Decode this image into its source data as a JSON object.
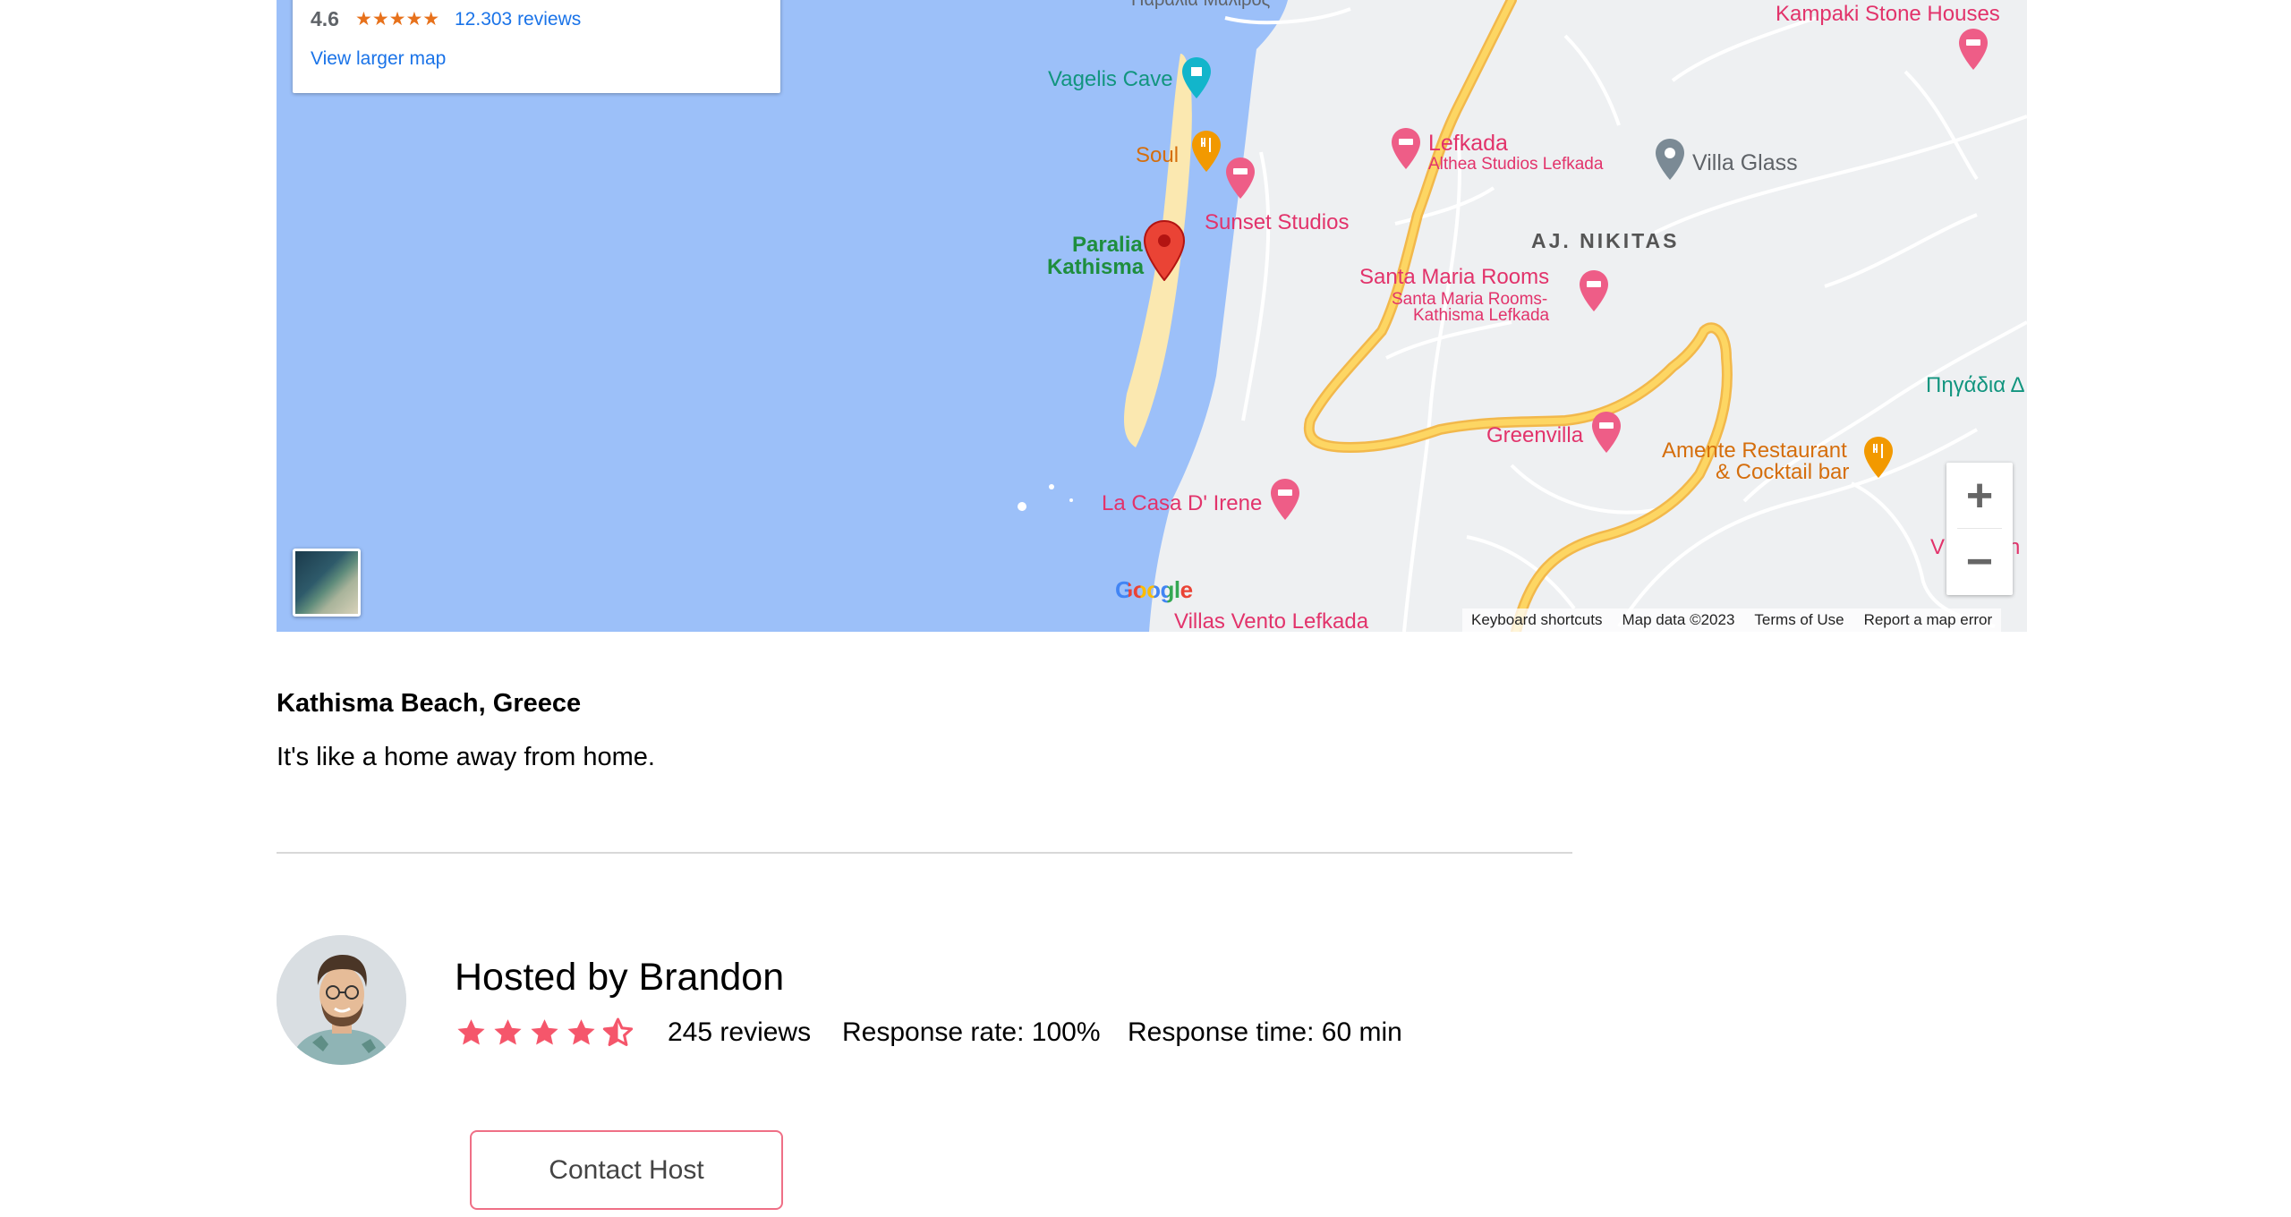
{
  "map": {
    "info_card": {
      "rating": "4.6",
      "stars": "★★★★★",
      "reviews_link": "12.303 reviews",
      "larger_map_link": "View larger map"
    },
    "labels": {
      "vagelis_cave": "Vagelis Cave",
      "soul": "Soul",
      "sunset_studios": "Sunset Studios",
      "paralia_kathisma_1": "Paralia",
      "paralia_kathisma_2": "Kathisma",
      "lefkada": "Lefkada",
      "althea": "Althea Studios Lefkada",
      "villa_glass": "Villa Glass",
      "aj_nikitas": "AJ. NIKITAS",
      "santa_maria": "Santa Maria Rooms",
      "santa_maria_sub_1": "Santa Maria Rooms-",
      "santa_maria_sub_2": "Kathisma Lefkada",
      "kampaki": "Kampaki Stone Houses",
      "pigadia": "Πηγάδια Δ",
      "greenvilla": "Greenvilla",
      "amente_1": "Amente Restaurant",
      "amente_2": "& Cocktail bar",
      "la_casa": "La Casa D' Irene",
      "villas_vento": "Villas Vento Lefkada",
      "partial_v": "V",
      "partial_n": "n",
      "top_partial": "Παραλία Μαλίρος"
    },
    "zoom_in": "+",
    "zoom_out": "−",
    "google_logo": "Google",
    "attribution": {
      "shortcuts": "Keyboard shortcuts",
      "data": "Map data ©2023",
      "terms": "Terms of Use",
      "report": "Report a map error"
    },
    "colors": {
      "water": "#9cc0f9",
      "land": "#eef0f2",
      "road": "#fdd663",
      "road_edge": "#f2b84b",
      "beach": "#fbe8b0",
      "poi_pink": "#e2336b",
      "marker_red": "#ea4335"
    }
  },
  "place": {
    "title": "Kathisma Beach, Greece",
    "description": "It's like a home away from home."
  },
  "host": {
    "name": "Hosted by Brandon",
    "rating": 4.5,
    "reviews": "245 reviews",
    "response_rate": "Response rate: 100%",
    "response_time": "Response time: 60 min",
    "star_color": "#f5566b",
    "contact_button": "Contact Host"
  }
}
